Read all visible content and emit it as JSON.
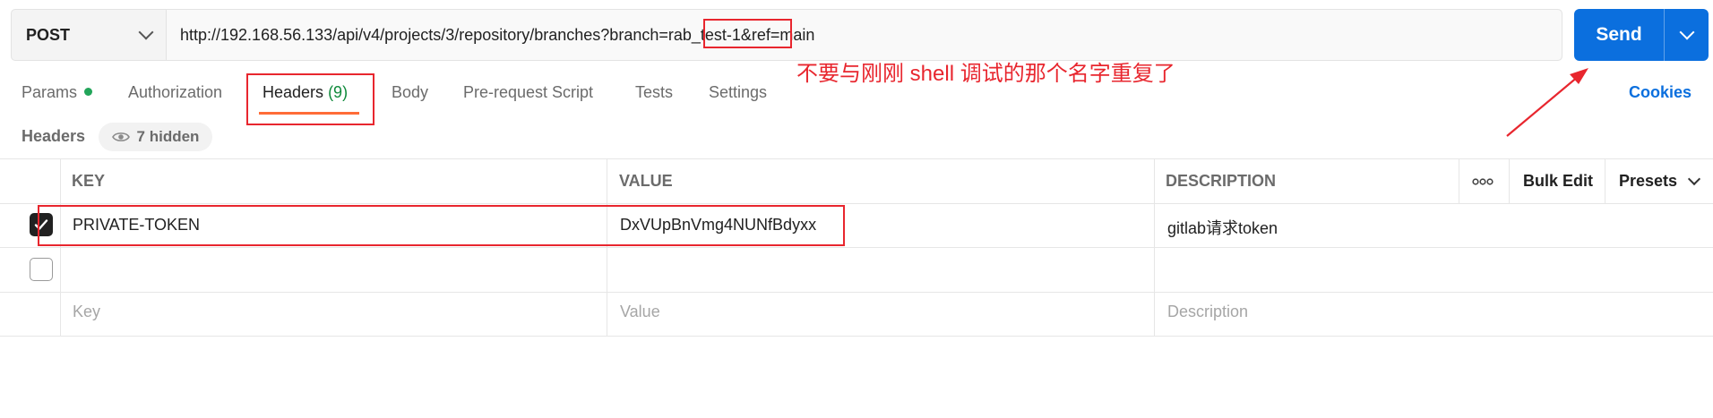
{
  "request": {
    "method": "POST",
    "url": "http://192.168.56.133/api/v4/projects/3/repository/branches?branch=rab_test-1&ref=main",
    "send_label": "Send"
  },
  "tabs": {
    "params": "Params",
    "authorization": "Authorization",
    "headers": "Headers",
    "headers_count": "(9)",
    "body": "Body",
    "pre_request": "Pre-request Script",
    "tests": "Tests",
    "settings": "Settings",
    "cookies": "Cookies"
  },
  "headers_section": {
    "title": "Headers",
    "hidden_label": "7 hidden"
  },
  "table": {
    "columns": {
      "key": "KEY",
      "value": "VALUE",
      "description": "DESCRIPTION"
    },
    "more_label": "ooo",
    "bulk_edit": "Bulk Edit",
    "presets": "Presets",
    "rows": [
      {
        "checked": true,
        "key": "PRIVATE-TOKEN",
        "value": "DxVUpBnVmg4NUNfBdyxx",
        "description": "gitlab请求token"
      },
      {
        "checked": false,
        "key": "",
        "value": "",
        "description": ""
      }
    ],
    "placeholders": {
      "key": "Key",
      "value": "Value",
      "description": "Description"
    }
  },
  "annotation": {
    "text": "不要与刚刚 shell 调试的那个名字重复了",
    "color": "#e8262e"
  },
  "colors": {
    "accent_blue": "#0b6fde",
    "tab_underline": "#ff6c37",
    "status_green": "#22a55a"
  },
  "icons": [
    "chevron-down-icon",
    "status-dot-icon",
    "eye-icon",
    "checkmark-icon",
    "more-horizontal-icon",
    "red-arrow-annotation"
  ]
}
